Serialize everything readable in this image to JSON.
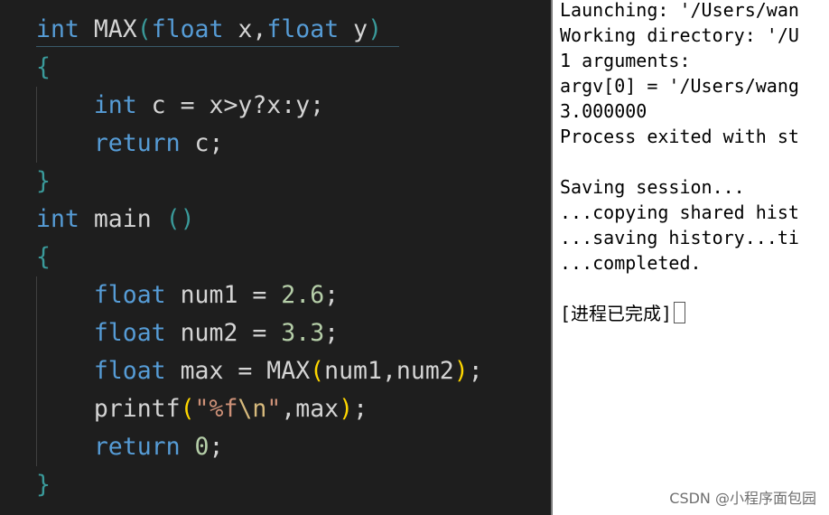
{
  "editor": {
    "max_sig": {
      "ret_type": "int",
      "name": "MAX",
      "open_paren": "(",
      "param1_type": "float",
      "param1_name": "x",
      "comma": ",",
      "param2_type": "float",
      "param2_name": "y",
      "close_paren": ")"
    },
    "max_open_brace": "{",
    "max_body": {
      "decl_type": "int",
      "decl_rest": "c = x>y?x:y;",
      "return_kw": "return",
      "return_rest": "c;"
    },
    "max_close_brace": "}",
    "main_sig": {
      "ret_type": "int",
      "name": "main",
      "parens": "()"
    },
    "main_open_brace": "{",
    "main_body": {
      "num1_type": "float",
      "num1_rest": "num1 =",
      "num1_value": "2.6",
      "num2_type": "float",
      "num2_rest": "num2 =",
      "num2_value": "3.3",
      "max_type": "float",
      "max_rest": "max = MAX",
      "max_open": "(",
      "max_args": "num1,num2",
      "max_close": ")",
      "max_semi": ";",
      "printf_name": "printf",
      "printf_open": "(",
      "printf_str_open": "\"%f",
      "printf_escape": "\\n",
      "printf_str_close": "\"",
      "printf_args": ",max",
      "printf_close": ")",
      "printf_semi": ";",
      "return_kw": "return",
      "return_value": "0",
      "return_semi": ";",
      "semi": ";"
    },
    "main_close_brace": "}"
  },
  "terminal": {
    "lines": [
      "Launching: '/Users/wan",
      "Working directory: '/U",
      "1 arguments:",
      "argv[0] = '/Users/wang",
      "3.000000",
      "Process exited with st",
      "",
      "Saving session...",
      "...copying shared hist",
      "...saving history...ti",
      "...completed.",
      "",
      "[进程已完成]"
    ]
  },
  "watermark": "CSDN @小程序面包园",
  "colors": {
    "editor_bg": "#1e1e1e",
    "keyword": "#569cd6",
    "number": "#b5cea8",
    "string": "#ce9178",
    "bracket_level1": "#ffd700",
    "bracket_level2": "#3a9a9a",
    "terminal_bg": "#ffffff"
  }
}
